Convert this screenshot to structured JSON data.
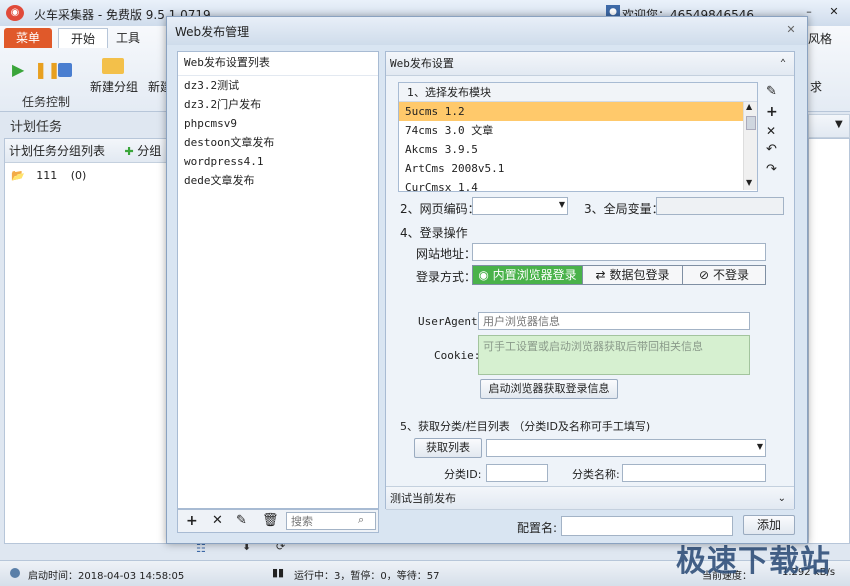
{
  "app": {
    "title": "火车采集器 - 免费版 9.5.1.0719",
    "welcome": "欢迎您：46549846546",
    "menu_tab": "菜单",
    "tabs": [
      "开始",
      "工具"
    ],
    "right_tab_fragment": "风格",
    "task_control_label": "任务控制",
    "new_group_label": "新建分组",
    "new_fragment": "新建",
    "right_button_fragment": "求",
    "plan_tasks_title": "计划任务",
    "group_list_header": "计划任务分组列表",
    "group_fragment": "分组",
    "group_items": [
      {
        "name": "111",
        "count": "(0)"
      }
    ],
    "status": {
      "start_time": "启动时间：2018-04-03 14:58:05",
      "running": "运行中：3，暂停：0，等待：57",
      "speed_label": "当前速度：",
      "speed_value": "1.292 kB/s"
    },
    "watermark": "极速下载站"
  },
  "dialog": {
    "title": "Web发布管理",
    "list_title": "Web发布设置列表",
    "list_items": [
      "dz3.2测试",
      "dz3.2门户发布",
      "phpcmsv9",
      "destoon文章发布",
      "wordpress4.1",
      "dede文章发布"
    ],
    "search_placeholder": "搜索",
    "settings_title": "Web发布设置",
    "step1_title": "1、选择发布模块",
    "modules": [
      "5ucms 1.2",
      "74cms 3.0 文章",
      "Akcms 3.9.5",
      "ArtCms 2008v5.1",
      "CurCmsx 1.4"
    ],
    "selected_module_index": 0,
    "step2_label": "2、网页编码：",
    "encoding_value": "",
    "step3_label": "3、全局变量：",
    "global_var_value": "",
    "step4_title": "4、登录操作",
    "site_url_label": "网站地址：",
    "site_url_value": "",
    "login_method_label": "登录方式：",
    "login_options": [
      "内置浏览器登录",
      "数据包登录",
      "不登录"
    ],
    "login_selected_index": 0,
    "useragent_label": "UserAgent:",
    "useragent_placeholder": "用户浏览器信息",
    "cookie_label": "Cookie:",
    "cookie_placeholder": "可手工设置或启动浏览器获取后带回相关信息",
    "launch_browser_button": "启动浏览器获取登录信息",
    "step5_title": "5、获取分类/栏目列表 （分类ID及名称可手工填写)",
    "get_list_button": "获取列表",
    "category_select_value": "",
    "category_id_label": "分类ID:",
    "category_id_value": "",
    "category_name_label": "分类名称:",
    "category_name_value": "",
    "test_publish_title": "测试当前发布",
    "config_name_label": "配置名:",
    "config_name_value": "",
    "add_button": "添加"
  },
  "colors": {
    "menu_tab": "#e0592a",
    "selected_row": "#ffc96b",
    "login_active": "#49b24a",
    "cookie_bg": "#d6f0d0",
    "accent_blue": "#3e6aa8"
  }
}
